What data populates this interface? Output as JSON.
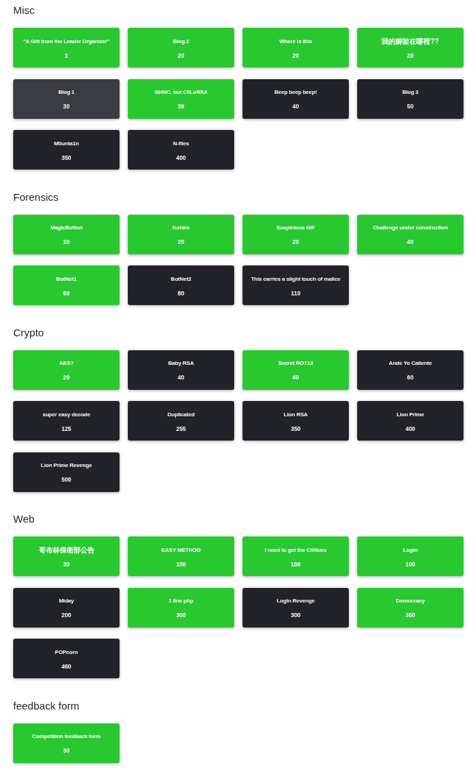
{
  "categories": [
    {
      "name": "Misc",
      "challenges": [
        {
          "title": "\"A Gift from the Leader Organizer\"",
          "points": "1",
          "solved": true,
          "hovered": false
        },
        {
          "title": "Blog 2",
          "points": "20",
          "solved": true,
          "hovered": false
        },
        {
          "title": "Where is this",
          "points": "20",
          "solved": true,
          "hovered": false
        },
        {
          "title": "我的腳架在哪裡??",
          "points": "20",
          "solved": true,
          "hovered": false
        },
        {
          "title": "Blog 1",
          "points": "30",
          "solved": false,
          "hovered": true
        },
        {
          "title": "NHNC, but C0LoRfUl",
          "points": "39",
          "solved": true,
          "hovered": false
        },
        {
          "title": "Beep beep beep!",
          "points": "40",
          "solved": false,
          "hovered": false
        },
        {
          "title": "Blog 3",
          "points": "50",
          "solved": false,
          "hovered": false
        },
        {
          "title": "M0unta1n",
          "points": "350",
          "solved": false,
          "hovered": false
        },
        {
          "title": "N-files",
          "points": "400",
          "solved": false,
          "hovered": false
        }
      ]
    },
    {
      "name": "Forensics",
      "challenges": [
        {
          "title": "MagicButton",
          "points": "10",
          "solved": true,
          "hovered": false
        },
        {
          "title": "Kohiro",
          "points": "20",
          "solved": true,
          "hovered": false
        },
        {
          "title": "Suspicious GIF",
          "points": "20",
          "solved": true,
          "hovered": false
        },
        {
          "title": "Challenge under construction",
          "points": "40",
          "solved": true,
          "hovered": false
        },
        {
          "title": "BotNet1",
          "points": "60",
          "solved": true,
          "hovered": false
        },
        {
          "title": "BotNet2",
          "points": "80",
          "solved": false,
          "hovered": false
        },
        {
          "title": "This carries a slight touch of malice",
          "points": "110",
          "solved": false,
          "hovered": false
        }
      ]
    },
    {
      "name": "Crypto",
      "challenges": [
        {
          "title": "AES?",
          "points": "20",
          "solved": true,
          "hovered": false
        },
        {
          "title": "Baby RSA",
          "points": "40",
          "solved": false,
          "hovered": false
        },
        {
          "title": "Secret ROT13",
          "points": "40",
          "solved": true,
          "hovered": false
        },
        {
          "title": "Ande Yo Caliente",
          "points": "60",
          "solved": false,
          "hovered": false
        },
        {
          "title": "super easy decode",
          "points": "125",
          "solved": false,
          "hovered": false
        },
        {
          "title": "Duplicated",
          "points": "255",
          "solved": false,
          "hovered": false
        },
        {
          "title": "Lion RSA",
          "points": "350",
          "solved": false,
          "hovered": false
        },
        {
          "title": "Lion Prime",
          "points": "400",
          "solved": false,
          "hovered": false
        },
        {
          "title": "Lion Prime Revenge",
          "points": "500",
          "solved": false,
          "hovered": false
        }
      ]
    },
    {
      "name": "Web",
      "challenges": [
        {
          "title": "哥布林保衛部公告",
          "points": "30",
          "solved": true,
          "hovered": false
        },
        {
          "title": "EASY METHOD",
          "points": "100",
          "solved": true,
          "hovered": false
        },
        {
          "title": "I need to get the C00kies",
          "points": "100",
          "solved": true,
          "hovered": false
        },
        {
          "title": "Login",
          "points": "100",
          "solved": true,
          "hovered": false
        },
        {
          "title": "Miday",
          "points": "200",
          "solved": false,
          "hovered": false
        },
        {
          "title": "1 line php",
          "points": "300",
          "solved": true,
          "hovered": false
        },
        {
          "title": "Login Revenge",
          "points": "300",
          "solved": false,
          "hovered": false
        },
        {
          "title": "Democracy",
          "points": "350",
          "solved": true,
          "hovered": false
        },
        {
          "title": "POPcorn",
          "points": "460",
          "solved": false,
          "hovered": false
        }
      ]
    },
    {
      "name": "feedback form",
      "challenges": [
        {
          "title": "Competition feedback form",
          "points": "30",
          "solved": true,
          "hovered": false
        }
      ]
    }
  ]
}
